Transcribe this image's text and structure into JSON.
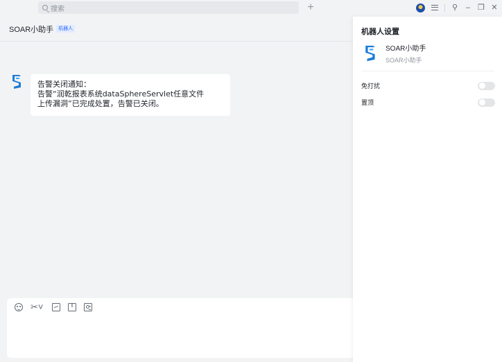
{
  "titlebar": {
    "search_placeholder": "搜索",
    "add_symbol": "+",
    "pin_symbol": "⚲",
    "minimize_symbol": "–",
    "restore_symbol": "❐",
    "close_symbol": "✕"
  },
  "chat": {
    "title": "SOAR小助手",
    "bot_tag": "机器人",
    "message": {
      "lines": [
        "告警关闭通知：",
        "告警“润乾报表系统dataSphereServlet任意文件",
        "上传漏洞”已完成处置，告警已关闭。"
      ]
    },
    "composer": {
      "icons": [
        "emoji-icon",
        "screenshot-scissors-icon",
        "image-icon",
        "file-icon",
        "contact-card-icon"
      ],
      "scissors_glyph": "✂˅"
    }
  },
  "settings_panel": {
    "title": "机器人设置",
    "bot_name": "SOAR小助手",
    "bot_desc": "SOAR小助手",
    "settings": [
      {
        "label": "免打扰",
        "enabled": false
      },
      {
        "label": "置顶",
        "enabled": false
      }
    ]
  },
  "colors": {
    "accent": "#3370ff",
    "logo_blue": "#1e7bd6",
    "background": "#f2f3f5"
  }
}
